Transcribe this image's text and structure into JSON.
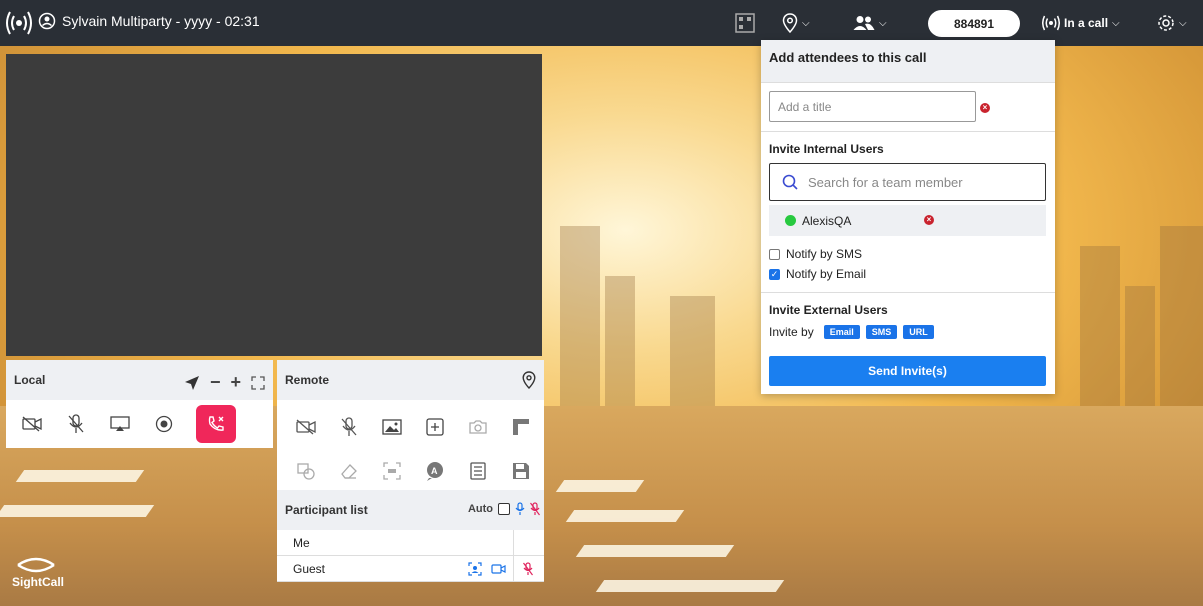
{
  "topbar": {
    "title": "Sylvain Multiparty - yyyy - 02:31",
    "room_code": "884891",
    "call_status": "In a call"
  },
  "local": {
    "label": "Local"
  },
  "remote": {
    "label": "Remote"
  },
  "participants": {
    "label": "Participant list",
    "auto_label": "Auto",
    "rows": [
      {
        "name": "Me"
      },
      {
        "name": "Guest"
      }
    ]
  },
  "brand": {
    "name": "SightCall"
  },
  "attendees": {
    "header": "Add attendees to this call",
    "title_placeholder": "Add a title",
    "internal_label": "Invite Internal Users",
    "search_placeholder": "Search for a team member",
    "selected_user": "AlexisQA",
    "notify_sms": "Notify by SMS",
    "notify_email": "Notify by Email",
    "external_label": "Invite External Users",
    "invite_by": "Invite by",
    "tags": [
      "Email",
      "SMS",
      "URL"
    ],
    "send_label": "Send Invite(s)"
  },
  "colors": {
    "topbar": "#2a2f36",
    "hangup": "#f0275a",
    "primary": "#1a7ff0"
  }
}
